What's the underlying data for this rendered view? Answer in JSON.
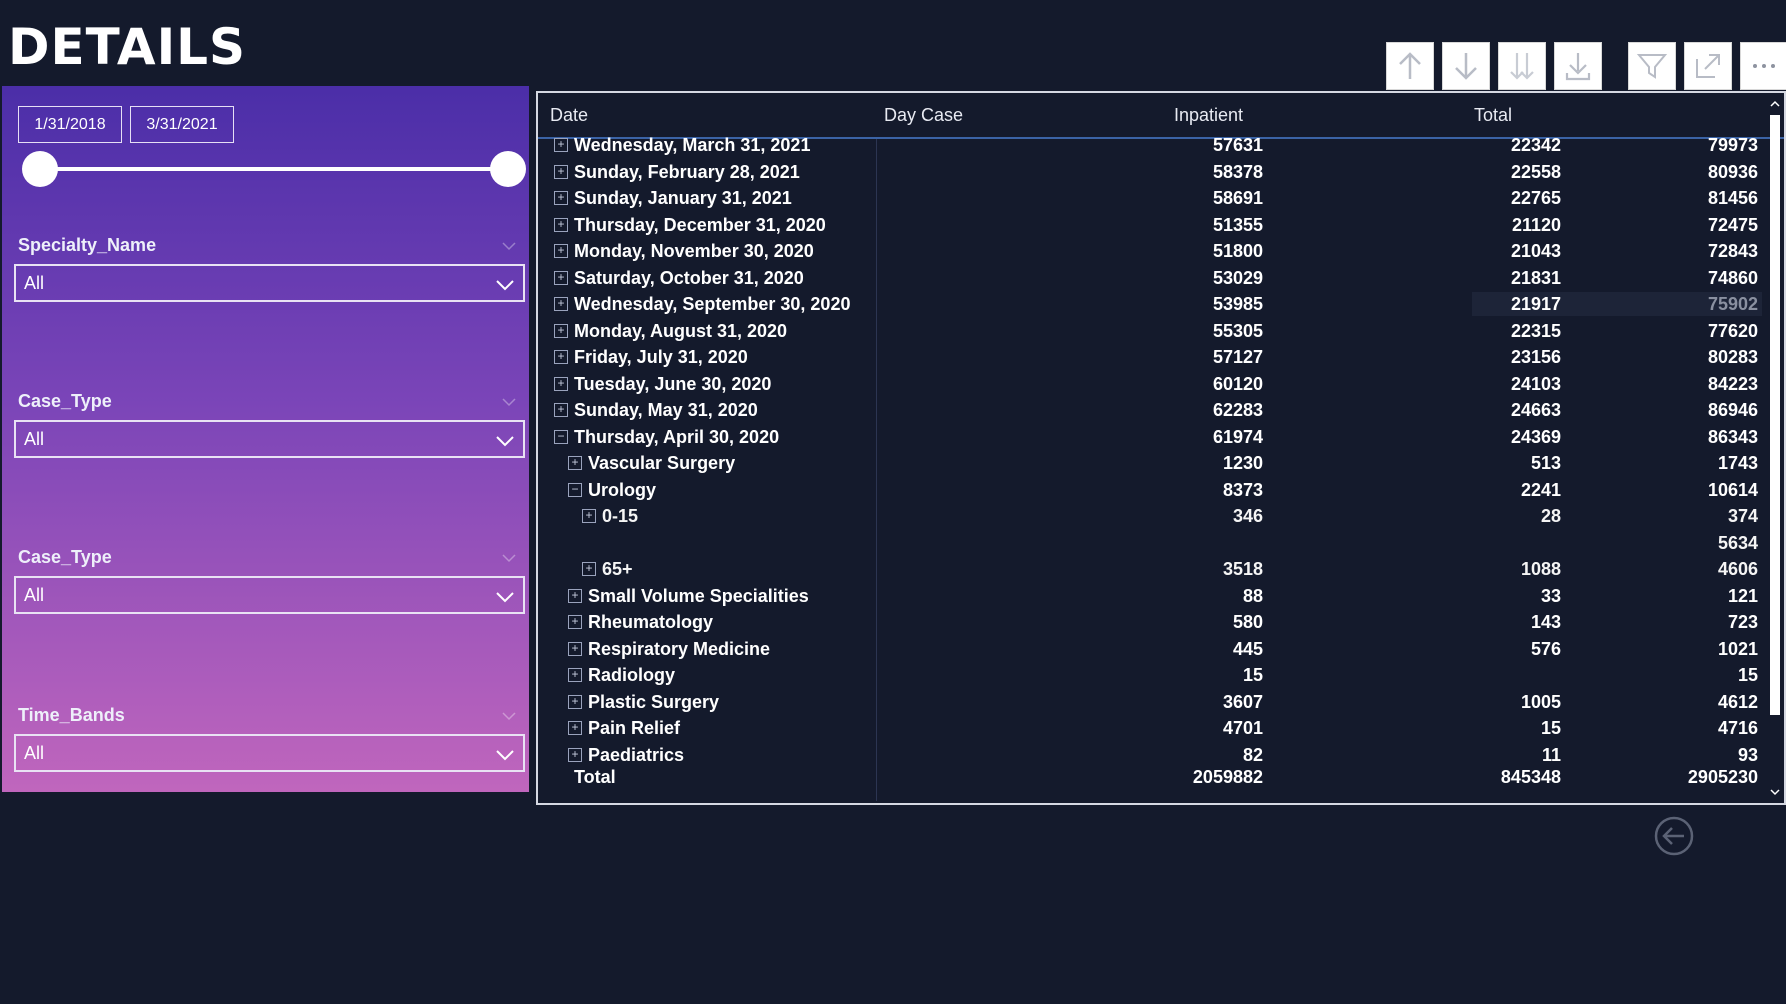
{
  "page": {
    "title": "DETAILS"
  },
  "toolbar": {
    "buttons": [
      {
        "name": "drill-up-icon"
      },
      {
        "name": "drill-down-icon"
      },
      {
        "name": "expand-next-level-icon"
      },
      {
        "name": "expand-all-icon"
      },
      {
        "name": "filter-icon"
      },
      {
        "name": "focus-mode-icon"
      },
      {
        "name": "more-options-icon"
      }
    ]
  },
  "slicers": {
    "date_range": {
      "start": "1/31/2018",
      "end": "3/31/2021"
    },
    "specialty": {
      "label": "Specialty_Name",
      "value": "All"
    },
    "case_type_1": {
      "label": "Case_Type",
      "value": "All"
    },
    "case_type_2": {
      "label": "Case_Type",
      "value": "All"
    },
    "time_bands": {
      "label": "Time_Bands",
      "value": "All"
    }
  },
  "table": {
    "headers": {
      "date": "Date",
      "day_case": "Day Case",
      "inpatient": "Inpatient",
      "total": "Total"
    },
    "rows": [
      {
        "level": 0,
        "exp": "+",
        "label": "Wednesday, March 31, 2021",
        "day_case": "57631",
        "inpatient": "22342",
        "total": "79973"
      },
      {
        "level": 0,
        "exp": "+",
        "label": "Sunday, February 28, 2021",
        "day_case": "58378",
        "inpatient": "22558",
        "total": "80936"
      },
      {
        "level": 0,
        "exp": "+",
        "label": "Sunday, January 31, 2021",
        "day_case": "58691",
        "inpatient": "22765",
        "total": "81456"
      },
      {
        "level": 0,
        "exp": "+",
        "label": "Thursday, December 31, 2020",
        "day_case": "51355",
        "inpatient": "21120",
        "total": "72475"
      },
      {
        "level": 0,
        "exp": "+",
        "label": "Monday, November 30, 2020",
        "day_case": "51800",
        "inpatient": "21043",
        "total": "72843"
      },
      {
        "level": 0,
        "exp": "+",
        "label": "Saturday, October 31, 2020",
        "day_case": "53029",
        "inpatient": "21831",
        "total": "74860"
      },
      {
        "level": 0,
        "exp": "+",
        "label": "Wednesday, September 30, 2020",
        "day_case": "53985",
        "inpatient": "21917",
        "total": "75902"
      },
      {
        "level": 0,
        "exp": "+",
        "label": "Monday, August 31, 2020",
        "day_case": "55305",
        "inpatient": "22315",
        "total": "77620"
      },
      {
        "level": 0,
        "exp": "+",
        "label": "Friday, July 31, 2020",
        "day_case": "57127",
        "inpatient": "23156",
        "total": "80283"
      },
      {
        "level": 0,
        "exp": "+",
        "label": "Tuesday, June 30, 2020",
        "day_case": "60120",
        "inpatient": "24103",
        "total": "84223"
      },
      {
        "level": 0,
        "exp": "+",
        "label": "Sunday, May 31, 2020",
        "day_case": "62283",
        "inpatient": "24663",
        "total": "86946"
      },
      {
        "level": 0,
        "exp": "−",
        "label": "Thursday, April 30, 2020",
        "day_case": "61974",
        "inpatient": "24369",
        "total": "86343"
      },
      {
        "level": 1,
        "exp": "+",
        "label": "Vascular Surgery",
        "day_case": "1230",
        "inpatient": "513",
        "total": "1743"
      },
      {
        "level": 1,
        "exp": "−",
        "label": "Urology",
        "day_case": "8373",
        "inpatient": "2241",
        "total": "10614"
      },
      {
        "level": 2,
        "exp": "+",
        "label": "0-15",
        "day_case": "346",
        "inpatient": "28",
        "total": "374"
      },
      {
        "level": 2,
        "exp": "",
        "label": "",
        "day_case": "",
        "inpatient": "",
        "total": "5634"
      },
      {
        "level": 2,
        "exp": "+",
        "label": "65+",
        "day_case": "3518",
        "inpatient": "1088",
        "total": "4606"
      },
      {
        "level": 1,
        "exp": "+",
        "label": "Small Volume Specialities",
        "day_case": "88",
        "inpatient": "33",
        "total": "121"
      },
      {
        "level": 1,
        "exp": "+",
        "label": "Rheumatology",
        "day_case": "580",
        "inpatient": "143",
        "total": "723"
      },
      {
        "level": 1,
        "exp": "+",
        "label": "Respiratory Medicine",
        "day_case": "445",
        "inpatient": "576",
        "total": "1021"
      },
      {
        "level": 1,
        "exp": "+",
        "label": "Radiology",
        "day_case": "15",
        "inpatient": "",
        "total": "15"
      },
      {
        "level": 1,
        "exp": "+",
        "label": "Plastic Surgery",
        "day_case": "3607",
        "inpatient": "1005",
        "total": "4612"
      },
      {
        "level": 1,
        "exp": "+",
        "label": "Pain Relief",
        "day_case": "4701",
        "inpatient": "15",
        "total": "4716"
      },
      {
        "level": 1,
        "exp": "+",
        "label": "Paediatrics",
        "day_case": "82",
        "inpatient": "11",
        "total": "93"
      }
    ],
    "total_row": {
      "label": "Total",
      "day_case": "2059882",
      "inpatient": "845348",
      "total": "2905230"
    }
  },
  "colors": {
    "background": "#141a2c",
    "header_underline": "#3b63a6",
    "panel_top": "#4b2ea8",
    "panel_bottom": "#c066bd"
  }
}
